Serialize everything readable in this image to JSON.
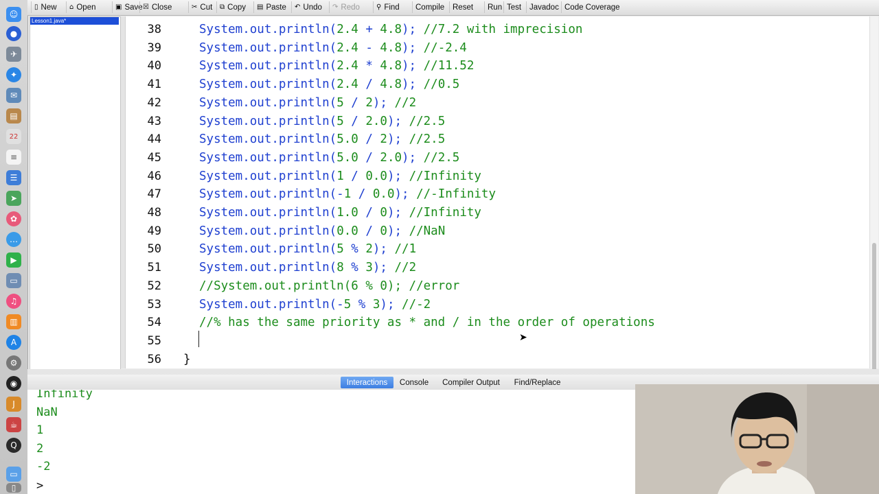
{
  "toolbar": {
    "buttons": [
      {
        "label": "New",
        "icon": "new-file-icon"
      },
      {
        "label": "Open",
        "icon": "open-folder-icon"
      },
      {
        "label": "Save",
        "icon": "save-icon"
      },
      {
        "label": "Close",
        "icon": "close-icon"
      },
      {
        "label": "Cut",
        "icon": "scissors-icon"
      },
      {
        "label": "Copy",
        "icon": "copy-icon"
      },
      {
        "label": "Paste",
        "icon": "paste-icon"
      },
      {
        "label": "Undo",
        "icon": "undo-icon"
      },
      {
        "label": "Redo",
        "icon": "redo-icon",
        "disabled": true
      },
      {
        "label": "Find",
        "icon": "binoculars-icon"
      },
      {
        "label": "Compile"
      },
      {
        "label": "Reset"
      },
      {
        "label": "Run"
      },
      {
        "label": "Test"
      },
      {
        "label": "Javadoc"
      },
      {
        "label": "Code Coverage"
      }
    ]
  },
  "files": [
    {
      "name": "Lesson1.java*",
      "selected": true
    }
  ],
  "editor": {
    "lines": [
      {
        "num": "38",
        "segments": [
          [
            "code",
            "System.out.println("
          ],
          [
            "num",
            "2.4"
          ],
          [
            "code",
            " + "
          ],
          [
            "num",
            "4.8"
          ],
          [
            "code",
            ");"
          ],
          [
            "cmt",
            " //7.2 with imprecision"
          ]
        ]
      },
      {
        "num": "39",
        "segments": [
          [
            "code",
            "System.out.println("
          ],
          [
            "num",
            "2.4"
          ],
          [
            "code",
            " - "
          ],
          [
            "num",
            "4.8"
          ],
          [
            "code",
            ");"
          ],
          [
            "cmt",
            " //-2.4"
          ]
        ]
      },
      {
        "num": "40",
        "segments": [
          [
            "code",
            "System.out.println("
          ],
          [
            "num",
            "2.4"
          ],
          [
            "code",
            " * "
          ],
          [
            "num",
            "4.8"
          ],
          [
            "code",
            ");"
          ],
          [
            "cmt",
            " //11.52"
          ]
        ]
      },
      {
        "num": "41",
        "segments": [
          [
            "code",
            "System.out.println("
          ],
          [
            "num",
            "2.4"
          ],
          [
            "code",
            " / "
          ],
          [
            "num",
            "4.8"
          ],
          [
            "code",
            ");"
          ],
          [
            "cmt",
            " //0.5"
          ]
        ]
      },
      {
        "num": "42",
        "segments": [
          [
            "code",
            "System.out.println("
          ],
          [
            "num",
            "5"
          ],
          [
            "code",
            " / "
          ],
          [
            "num",
            "2"
          ],
          [
            "code",
            ");"
          ],
          [
            "cmt",
            " //2"
          ]
        ]
      },
      {
        "num": "43",
        "segments": [
          [
            "code",
            "System.out.println("
          ],
          [
            "num",
            "5"
          ],
          [
            "code",
            " / "
          ],
          [
            "num",
            "2.0"
          ],
          [
            "code",
            ");"
          ],
          [
            "cmt",
            " //2.5"
          ]
        ]
      },
      {
        "num": "44",
        "segments": [
          [
            "code",
            "System.out.println("
          ],
          [
            "num",
            "5.0"
          ],
          [
            "code",
            " / "
          ],
          [
            "num",
            "2"
          ],
          [
            "code",
            ");"
          ],
          [
            "cmt",
            " //2.5"
          ]
        ]
      },
      {
        "num": "45",
        "segments": [
          [
            "code",
            "System.out.println("
          ],
          [
            "num",
            "5.0"
          ],
          [
            "code",
            " / "
          ],
          [
            "num",
            "2.0"
          ],
          [
            "code",
            ");"
          ],
          [
            "cmt",
            " //2.5"
          ]
        ]
      },
      {
        "num": "46",
        "segments": [
          [
            "code",
            "System.out.println("
          ],
          [
            "num",
            "1"
          ],
          [
            "code",
            " / "
          ],
          [
            "num",
            "0.0"
          ],
          [
            "code",
            ");"
          ],
          [
            "cmt",
            " //Infinity"
          ]
        ]
      },
      {
        "num": "47",
        "segments": [
          [
            "code",
            "System.out.println(-"
          ],
          [
            "num",
            "1"
          ],
          [
            "code",
            " / "
          ],
          [
            "num",
            "0.0"
          ],
          [
            "code",
            ");"
          ],
          [
            "cmt",
            " //-Infinity"
          ]
        ]
      },
      {
        "num": "48",
        "segments": [
          [
            "code",
            "System.out.println("
          ],
          [
            "num",
            "1.0"
          ],
          [
            "code",
            " / "
          ],
          [
            "num",
            "0"
          ],
          [
            "code",
            ");"
          ],
          [
            "cmt",
            " //Infinity"
          ]
        ]
      },
      {
        "num": "49",
        "segments": [
          [
            "code",
            "System.out.println("
          ],
          [
            "num",
            "0.0"
          ],
          [
            "code",
            " / "
          ],
          [
            "num",
            "0"
          ],
          [
            "code",
            ");"
          ],
          [
            "cmt",
            " //NaN"
          ]
        ]
      },
      {
        "num": "50",
        "segments": [
          [
            "code",
            "System.out.println("
          ],
          [
            "num",
            "5"
          ],
          [
            "code",
            " % "
          ],
          [
            "num",
            "2"
          ],
          [
            "code",
            ");"
          ],
          [
            "cmt",
            " //1"
          ]
        ]
      },
      {
        "num": "51",
        "segments": [
          [
            "code",
            "System.out.println("
          ],
          [
            "num",
            "8"
          ],
          [
            "code",
            " % "
          ],
          [
            "num",
            "3"
          ],
          [
            "code",
            ");"
          ],
          [
            "cmt",
            " //2"
          ]
        ]
      },
      {
        "num": "52",
        "segments": [
          [
            "cmt",
            "//System.out.println(6 % 0); //error"
          ]
        ]
      },
      {
        "num": "53",
        "segments": [
          [
            "code",
            "System.out.println(-"
          ],
          [
            "num",
            "5"
          ],
          [
            "code",
            " % "
          ],
          [
            "num",
            "3"
          ],
          [
            "code",
            ");"
          ],
          [
            "cmt",
            " //-2"
          ]
        ]
      },
      {
        "num": "54",
        "segments": [
          [
            "cmt",
            "//% has the same priority as * and / in the order of operations"
          ]
        ]
      },
      {
        "num": "55",
        "segments": []
      },
      {
        "num": "56",
        "segments": [
          [
            "plain",
            "}"
          ]
        ],
        "brace": true
      }
    ]
  },
  "bottom_tabs": [
    {
      "label": "Interactions",
      "active": true
    },
    {
      "label": "Console"
    },
    {
      "label": "Compiler Output"
    },
    {
      "label": "Find/Replace"
    }
  ],
  "console_output": [
    "Infinity",
    "NaN",
    "1",
    "2",
    "-2"
  ],
  "prompt": ">",
  "colors": {
    "code": "#1e3fd0",
    "literal": "#1c8c1c",
    "comment": "#1c8c1c",
    "selection": "#1d4fd8",
    "active_tab": "#3c7ee2"
  }
}
